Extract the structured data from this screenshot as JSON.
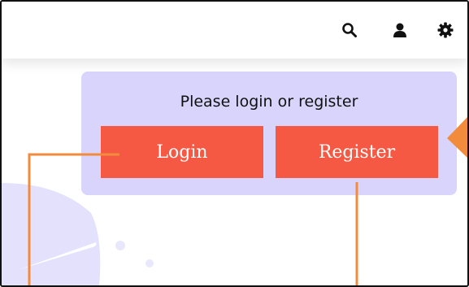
{
  "header": {
    "icons": [
      "search-icon",
      "user-icon",
      "gear-icon"
    ]
  },
  "login_card": {
    "prompt": "Please login or register",
    "login_label": "Login",
    "register_label": "Register"
  },
  "colors": {
    "card_background": "#d9d4fb",
    "button": "#f55843",
    "callout": "#f28c3c"
  }
}
